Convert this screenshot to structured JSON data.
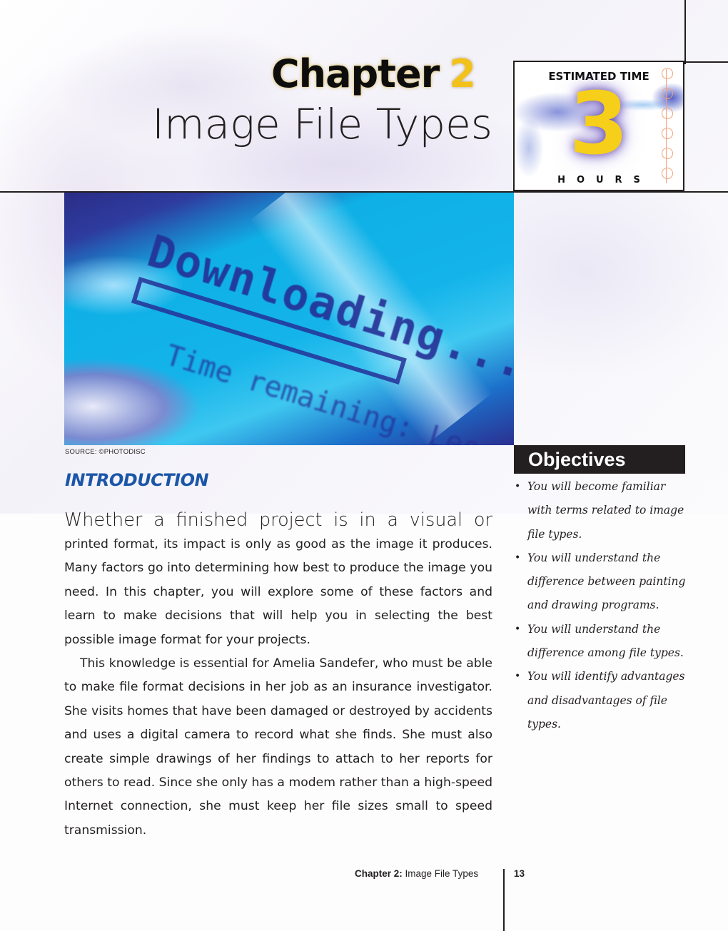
{
  "header": {
    "chapter_label": "Chapter",
    "chapter_number": "2",
    "chapter_title": "Image File Types"
  },
  "estimated_time": {
    "top_label": "ESTIMATED TIME",
    "value": "3",
    "unit_label": "HOURS"
  },
  "photo": {
    "alt": "Downloading... progress screen",
    "text_main": "Downloading...",
    "text_sub": "Time remaining: Less than",
    "credit": "SOURCE: ©PHOTODISC"
  },
  "introduction": {
    "heading": "INTRODUCTION",
    "lead": "Whether a finished project is in a visual or",
    "paragraph1_rest": "printed format, its impact is only as good as the image it produces. Many factors go into determining how best to produce the image you need. In this chapter, you will explore some of these factors and learn to make decisions that will help you in selecting the best possible image format for your projects.",
    "paragraph2": "This knowledge is essential for Amelia Sandefer, who must be able to make file format decisions in her job as an insurance investigator. She visits homes that have been damaged or destroyed by accidents and uses a digital camera to record what she finds. She must also create simple drawings of her findings to attach to her reports for others to read. Since she only has a modem rather than a high-speed Internet connection, she must keep her file sizes small to speed transmission."
  },
  "objectives": {
    "heading": "Objectives",
    "items": [
      "You will become familiar with terms related to image file types.",
      "You will understand the difference between painting and drawing programs.",
      "You will understand the difference among file types.",
      "You will identify advantages and disadvantages of file types."
    ]
  },
  "footer": {
    "chapter_bold": "Chapter 2:",
    "chapter_title": "Image File Types",
    "page_number": "13"
  }
}
